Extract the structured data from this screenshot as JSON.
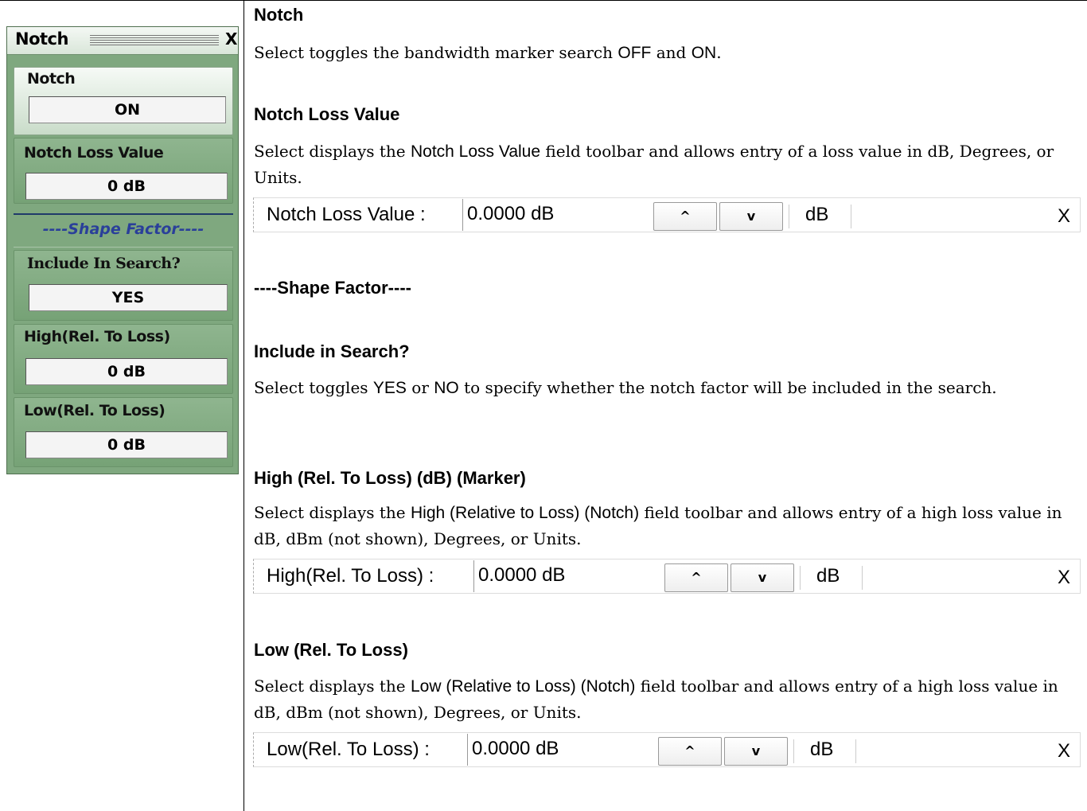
{
  "menu": {
    "title": "Notch",
    "close": "X",
    "notch_label": "Notch",
    "notch_value": "ON",
    "loss_label": "Notch Loss Value",
    "loss_value": "0  dB",
    "shape_header": "----Shape Factor----",
    "include_label": "Include In Search?",
    "include_value": "YES",
    "high_label": "High(Rel. To Loss)",
    "high_value": "0  dB",
    "low_label": "Low(Rel. To Loss)",
    "low_value": "0  dB"
  },
  "doc": {
    "notch": {
      "heading": "Notch",
      "text_pre": "Select toggles the bandwidth marker search ",
      "off": "OFF",
      "and": " and ",
      "on": "ON",
      "end": "."
    },
    "loss": {
      "heading": "Notch Loss Value",
      "text_pre": "Select displays the ",
      "field": "Notch Loss Value",
      "text_post": " field toolbar and allows entry of a loss value in dB, Degrees, or Units."
    },
    "shape": {
      "heading": "----Shape Factor----"
    },
    "include": {
      "heading": "Include in Search?",
      "text_pre": "Select toggles ",
      "yes": "YES",
      "or": " or ",
      "no": "NO",
      "text_post": " to specify whether the notch factor will be included in the search."
    },
    "high": {
      "heading": "High (Rel. To Loss) (dB) (Marker)",
      "text_pre": "Select displays the ",
      "field": "High (Relative to Loss) (Notch)",
      "text_post": " field toolbar and allows entry of a high loss value in dB, dBm (not shown), Degrees, or Units."
    },
    "low": {
      "heading": "Low (Rel. To Loss)",
      "text_pre": "Select displays the ",
      "field": "Low (Relative to Loss) (Notch)",
      "text_post": " field toolbar and allows entry of a high loss value in dB, dBm (not shown), Degrees, or Units."
    }
  },
  "toolbars": [
    {
      "label": "Notch Loss Value  :",
      "value": "0.0000  dB",
      "up": "^",
      "down": "v",
      "unit": "dB",
      "close": "X"
    },
    {
      "label": "High(Rel. To Loss)  :",
      "value": "0.0000  dB",
      "up": "^",
      "down": "v",
      "unit": "dB",
      "close": "X"
    },
    {
      "label": "Low(Rel. To Loss)  :",
      "value": "0.0000  dB",
      "up": "^",
      "down": "v",
      "unit": "dB",
      "close": "X"
    }
  ]
}
